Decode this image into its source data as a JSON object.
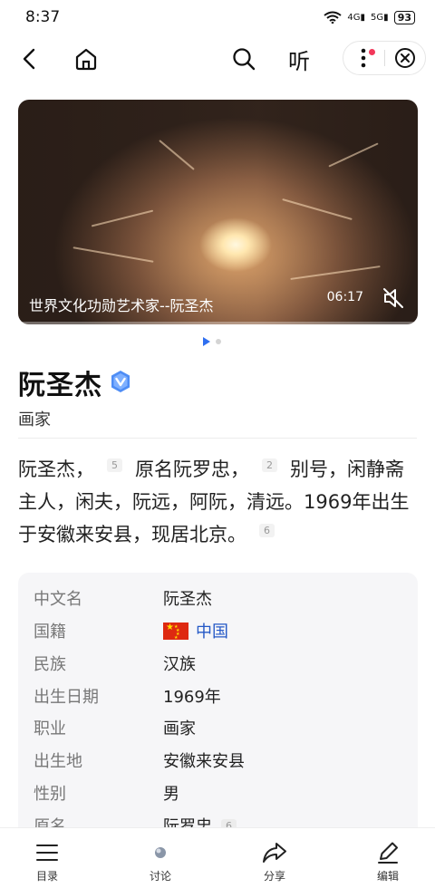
{
  "status_bar": {
    "time": "8:37",
    "net1": "4G",
    "net2": "5G",
    "battery": "93"
  },
  "nav": {
    "listen_label": "听"
  },
  "video": {
    "caption": "世界文化功勋艺术家--阮圣杰",
    "duration": "06:17"
  },
  "entry": {
    "title": "阮圣杰",
    "subtitle": "画家",
    "summary": {
      "part1": "阮圣杰，",
      "ref1": "5",
      "part2": "原名阮罗忠，",
      "ref2": "2",
      "part3": "别号，闲静斋主人，闲夫，阮远，阿阮，清远。1969年出生于安徽来安县，现居北京。",
      "ref3": "6"
    }
  },
  "info_rows": [
    {
      "key": "中文名",
      "value": "阮圣杰"
    },
    {
      "key": "国籍",
      "value": "中国"
    },
    {
      "key": "民族",
      "value": "汉族"
    },
    {
      "key": "出生日期",
      "value": "1969年"
    },
    {
      "key": "职业",
      "value": "画家"
    },
    {
      "key": "出生地",
      "value": "安徽来安县"
    },
    {
      "key": "性别",
      "value": "男"
    },
    {
      "key": "原名",
      "value": "阮罗忠",
      "ref": "6"
    }
  ],
  "tab_bar": {
    "catalog": "目录",
    "discuss": "讨论",
    "share": "分享",
    "edit": "编辑"
  },
  "colors": {
    "link": "#2458c6",
    "accent": "#2f6ff0",
    "notify": "#f2385a"
  }
}
